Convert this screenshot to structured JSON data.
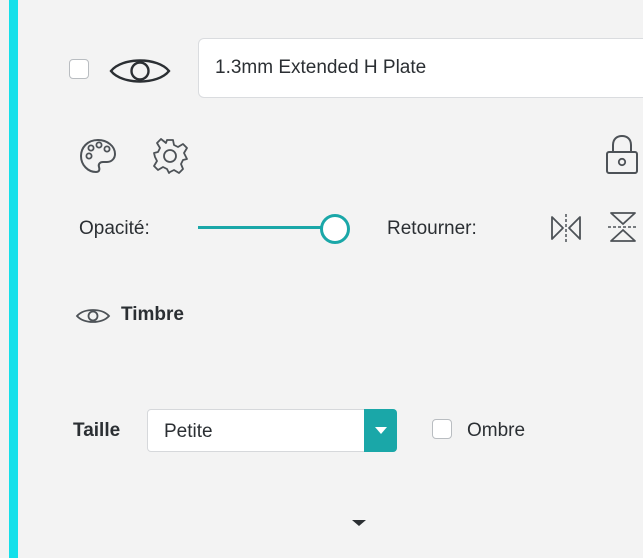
{
  "layer": {
    "name_value": "1.3mm Extended H Plate",
    "selected": false,
    "visible": true
  },
  "toolbar": {
    "icons": [
      "palette-icon",
      "gear-icon",
      "lock-icon"
    ]
  },
  "opacity": {
    "label": "Opacité:",
    "value_percent": 100
  },
  "flip": {
    "label": "Retourner:",
    "icons": [
      "flip-horizontal-icon",
      "flip-vertical-icon"
    ]
  },
  "stamp": {
    "label": "Timbre"
  },
  "size": {
    "label": "Taille",
    "selected": "Petite"
  },
  "shadow": {
    "label": "Ombre",
    "checked": false
  },
  "colors": {
    "accent_bar": "#14e0ea",
    "teal": "#1aa7a8",
    "text": "#2b2f33",
    "panel_bg": "#f3f3f3"
  }
}
